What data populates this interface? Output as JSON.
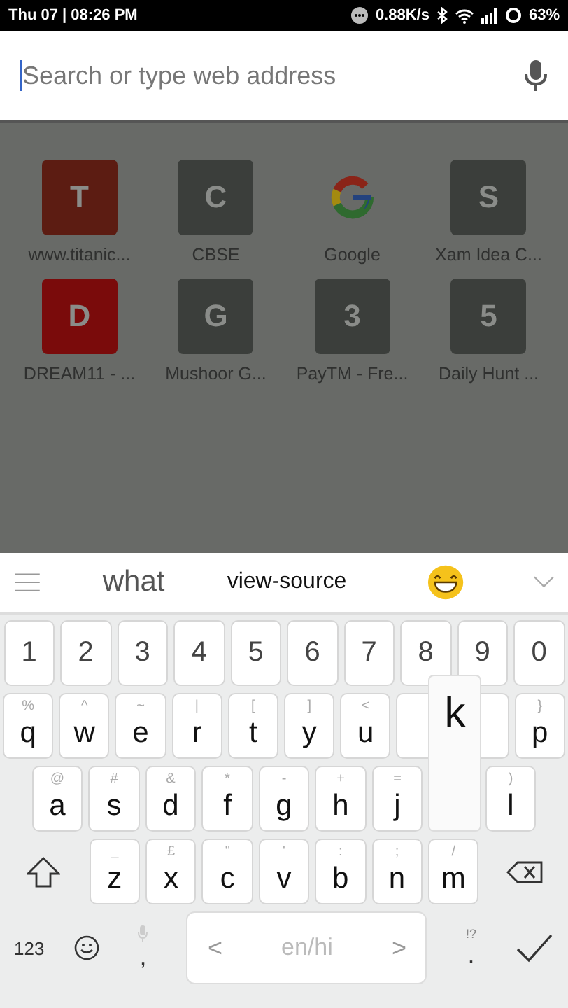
{
  "status_bar": {
    "time": "Thu 07 | 08:26 PM",
    "speed": "0.88K/s",
    "battery": "63%"
  },
  "search": {
    "placeholder": "Search or type web address"
  },
  "shortcuts": [
    {
      "kind": "letter",
      "letter": "T",
      "label": "www.titanic...",
      "color": "#5c1c12"
    },
    {
      "kind": "letter",
      "letter": "C",
      "label": "CBSE",
      "color": "#3b3e3b"
    },
    {
      "kind": "logo",
      "label": "Google"
    },
    {
      "kind": "letter",
      "letter": "S",
      "label": "Xam Idea C...",
      "color": "#3b3e3b"
    },
    {
      "kind": "letter",
      "letter": "D",
      "label": "DREAM11 - ...",
      "color": "#7a0b0b"
    },
    {
      "kind": "letter",
      "letter": "G",
      "label": "Mushoor G...",
      "color": "#3b3e3b"
    },
    {
      "kind": "letter",
      "letter": "3",
      "label": "PayTM - Fre...",
      "color": "#3b3e3b"
    },
    {
      "kind": "letter",
      "letter": "5",
      "label": "Daily Hunt ...",
      "color": "#3b3e3b"
    }
  ],
  "suggestions": [
    "what",
    "view-source"
  ],
  "number_row": [
    "1",
    "2",
    "3",
    "4",
    "5",
    "6",
    "7",
    "8",
    "9",
    "0"
  ],
  "rows": [
    [
      {
        "key": "q",
        "hint": "%"
      },
      {
        "key": "w",
        "hint": "^"
      },
      {
        "key": "e",
        "hint": "~"
      },
      {
        "key": "r",
        "hint": "|"
      },
      {
        "key": "t",
        "hint": "["
      },
      {
        "key": "y",
        "hint": "]"
      },
      {
        "key": "u",
        "hint": "<"
      },
      {
        "covered": true
      },
      {
        "covered": true
      },
      {
        "key": "p",
        "hint": "}"
      }
    ],
    [
      {
        "key": "a",
        "hint": "@"
      },
      {
        "key": "s",
        "hint": "#"
      },
      {
        "key": "d",
        "hint": "&"
      },
      {
        "key": "f",
        "hint": "*"
      },
      {
        "key": "g",
        "hint": "-"
      },
      {
        "key": "h",
        "hint": "+"
      },
      {
        "key": "j",
        "hint": "="
      },
      {
        "key": "k",
        "pressed": true
      },
      {
        "key": "l",
        "hint": ")"
      }
    ],
    [
      {
        "key": "z",
        "hint": "_"
      },
      {
        "key": "x",
        "hint": "£"
      },
      {
        "key": "c",
        "hint": "\""
      },
      {
        "key": "v",
        "hint": "'"
      },
      {
        "key": "b",
        "hint": ":"
      },
      {
        "key": "n",
        "hint": ";"
      },
      {
        "key": "m",
        "hint": "/"
      }
    ]
  ],
  "bottom_row": {
    "numbers": "123",
    "comma": ",",
    "prev": "<",
    "language": "en/hi",
    "next": ">",
    "period": ".",
    "period_hint": "!?"
  }
}
